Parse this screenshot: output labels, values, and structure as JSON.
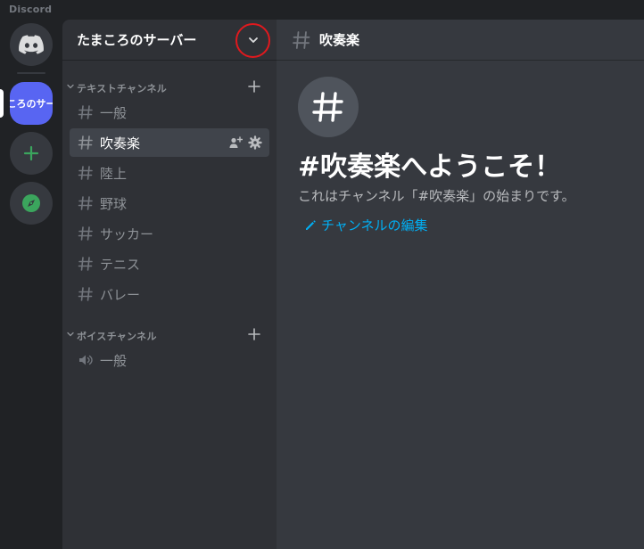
{
  "app": {
    "name": "Discord"
  },
  "colors": {
    "blurple": "#5865f2",
    "green": "#3ba55d",
    "link": "#00aff4",
    "annotation": "#e0191e"
  },
  "rail": {
    "home_icon": "discord-logo-icon",
    "server_label": "ころのサー",
    "add_icon": "plus-icon",
    "explore_icon": "compass-icon"
  },
  "server": {
    "name": "たまころのサーバー",
    "dropdown_icon": "chevron-down-icon"
  },
  "categories": [
    {
      "label": "テキストチャンネル",
      "channels": [
        {
          "label": "一般",
          "type": "text"
        },
        {
          "label": "吹奏楽",
          "type": "text",
          "active": true
        },
        {
          "label": "陸上",
          "type": "text"
        },
        {
          "label": "野球",
          "type": "text"
        },
        {
          "label": "サッカー",
          "type": "text"
        },
        {
          "label": "テニス",
          "type": "text"
        },
        {
          "label": "バレー",
          "type": "text"
        }
      ]
    },
    {
      "label": "ボイスチャンネル",
      "channels": [
        {
          "label": "一般",
          "type": "voice"
        }
      ]
    }
  ],
  "main": {
    "channel_title": "吹奏楽",
    "welcome_title": "#吹奏楽へようこそ！",
    "welcome_desc": "これはチャンネル「#吹奏楽」の始まりです。",
    "edit_link": "チャンネルの編集"
  }
}
